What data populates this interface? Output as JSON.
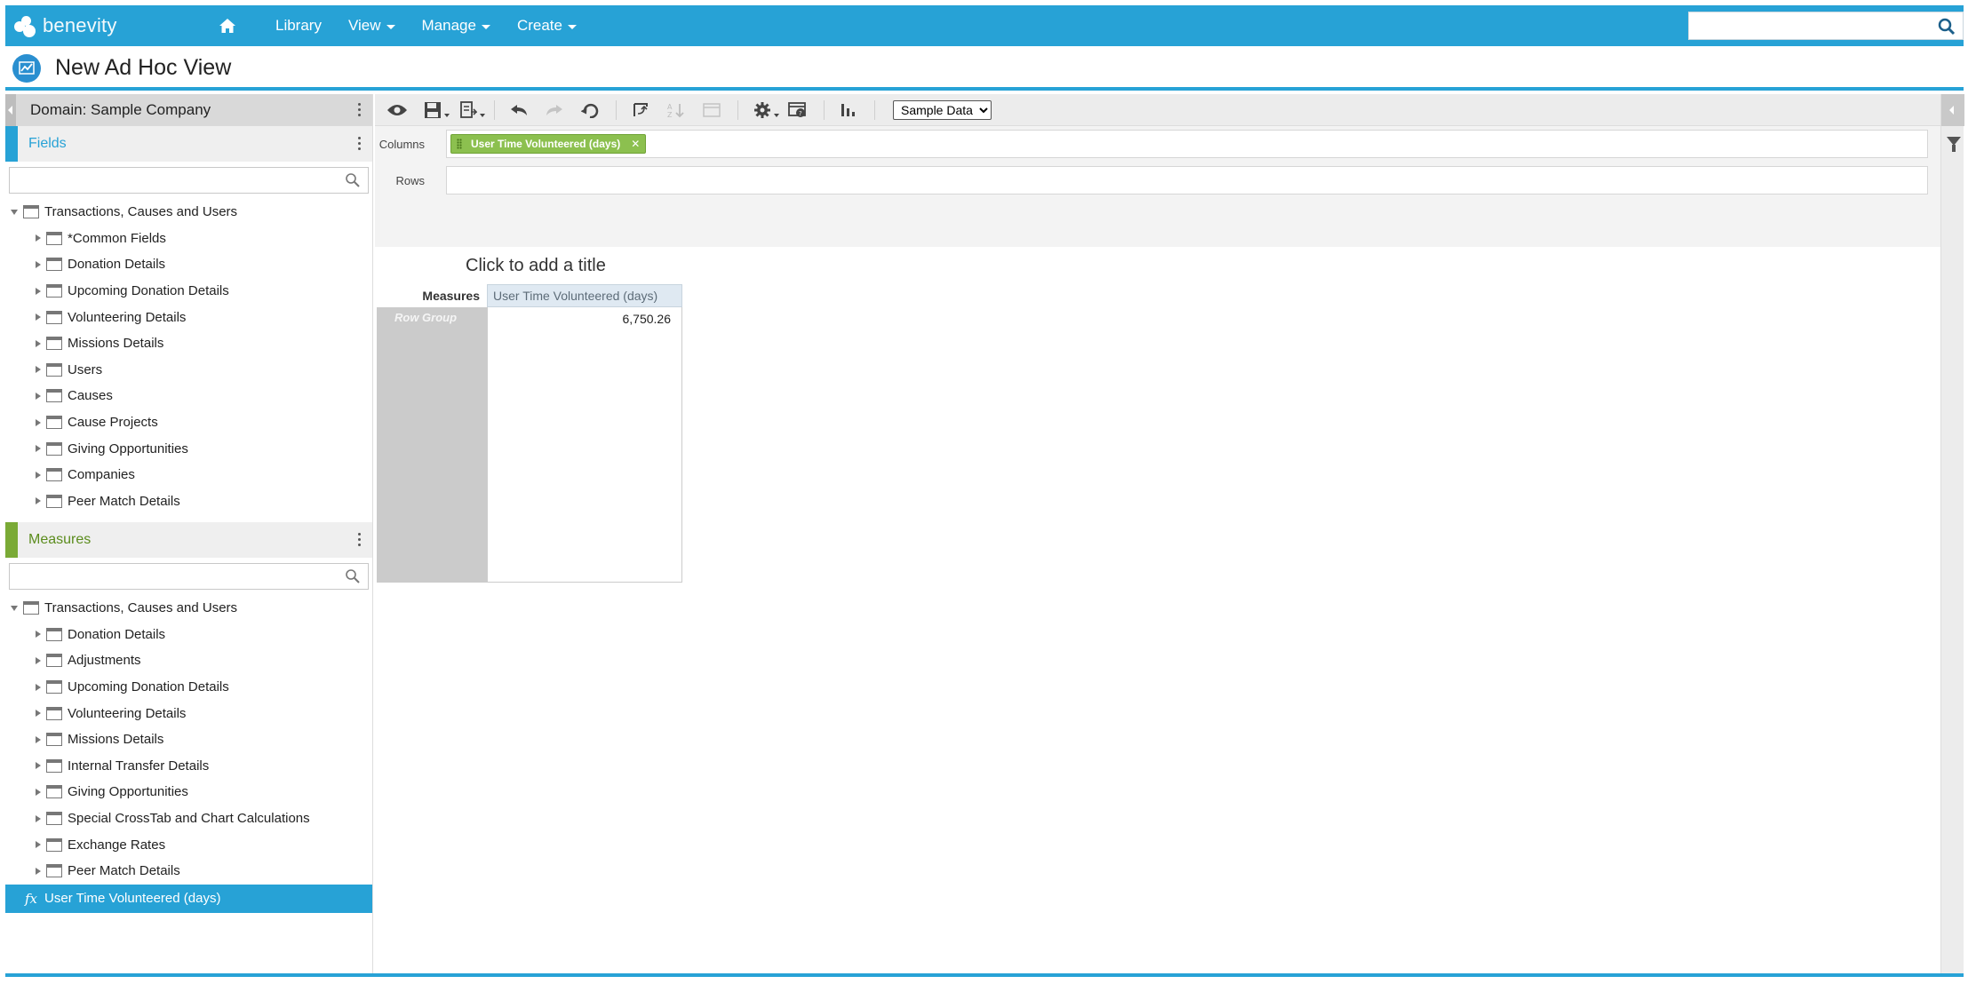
{
  "topbar": {
    "logo_text": "benevity",
    "nav": [
      {
        "label": "Library",
        "dropdown": false
      },
      {
        "label": "View",
        "dropdown": true
      },
      {
        "label": "Manage",
        "dropdown": true
      },
      {
        "label": "Create",
        "dropdown": true
      }
    ],
    "search_value": "",
    "accent_color": "#27a2d6"
  },
  "page": {
    "title": "New Ad Hoc View"
  },
  "left_panel": {
    "domain_label": "Domain: Sample Company",
    "fields": {
      "header": "Fields",
      "filter_value": "",
      "root": "Transactions, Causes and Users",
      "items": [
        "*Common Fields",
        "Donation Details",
        "Upcoming Donation Details",
        "Volunteering Details",
        "Missions Details",
        "Users",
        "Causes",
        "Cause Projects",
        "Giving Opportunities",
        "Companies",
        "Peer Match Details"
      ]
    },
    "measures": {
      "header": "Measures",
      "filter_value": "",
      "root": "Transactions, Causes and Users",
      "items": [
        "Donation Details",
        "Adjustments",
        "Upcoming Donation Details",
        "Volunteering Details",
        "Missions Details",
        "Internal Transfer Details",
        "Giving Opportunities",
        "Special CrossTab and Chart Calculations",
        "Exchange Rates",
        "Peer Match Details"
      ],
      "selected_icon": "fx",
      "selected": "User Time Volunteered (days)"
    }
  },
  "toolbar": {
    "icons": [
      "eye-icon",
      "save-icon",
      "export-icon",
      "undo-icon",
      "redo-icon",
      "undo-all-icon",
      "pivot-icon",
      "sort-icon",
      "layout-icon",
      "gear-icon",
      "sql-icon",
      "chart-icon"
    ],
    "data_source_selected": "Sample Data",
    "data_source_options": [
      "Sample Data"
    ]
  },
  "dropzone": {
    "columns_label": "Columns",
    "rows_label": "Rows",
    "columns_pills": [
      "User Time Volunteered (days)"
    ],
    "pill_color": "#8cc04f"
  },
  "crosstab": {
    "title_placeholder": "Click to add a title",
    "measures_label": "Measures",
    "column_header": "User Time Volunteered (days)",
    "row_group_label": "Row Group",
    "value": "6,750.26"
  }
}
